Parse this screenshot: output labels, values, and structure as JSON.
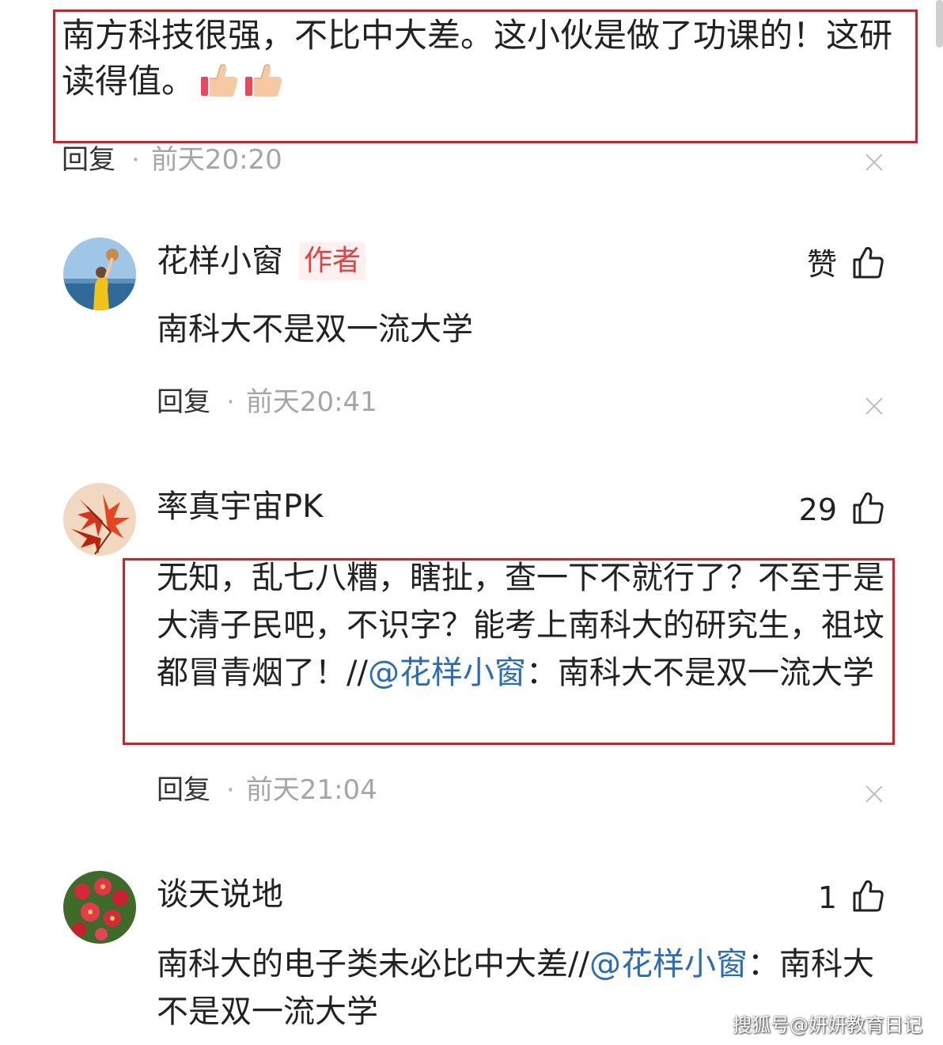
{
  "top_comment": {
    "text_before": "南方科技很强，不比中大差。这小伙是做了功课的！这研读得值。",
    "emoji": "thumbs-up-icon"
  },
  "meta_top": {
    "reply": "回复",
    "sep": "·",
    "time": "前天20:20"
  },
  "comments": [
    {
      "name": "花样小窗",
      "tag": "作者",
      "likes": "赞",
      "text": "南科大不是双一流大学",
      "reply": "回复",
      "sep": "·",
      "time": "前天20:41"
    },
    {
      "name": "率真宇宙PK",
      "likes": "29",
      "text_main": "无知，乱七八糟，瞎扯，查一下不就行了？不至于是大清子民吧，不识字？能考上南科大的研究生，祖坟都冒青烟了！//",
      "mention": "@花样小窗",
      "text_tail": "：南科大不是双一流大学",
      "reply": "回复",
      "sep": "·",
      "time": "前天21:04"
    },
    {
      "name": "谈天说地",
      "likes": "1",
      "text_main": "南科大的电子类未必比中大差//",
      "mention": "@花样小窗",
      "text_tail": "：南科大不是双一流大学"
    }
  ],
  "watermark": "搜狐号@妍妍教育日记",
  "colors": {
    "highlight_box": "#d4202c",
    "mention": "#2b6cb8",
    "author_tag": "#e04141"
  }
}
